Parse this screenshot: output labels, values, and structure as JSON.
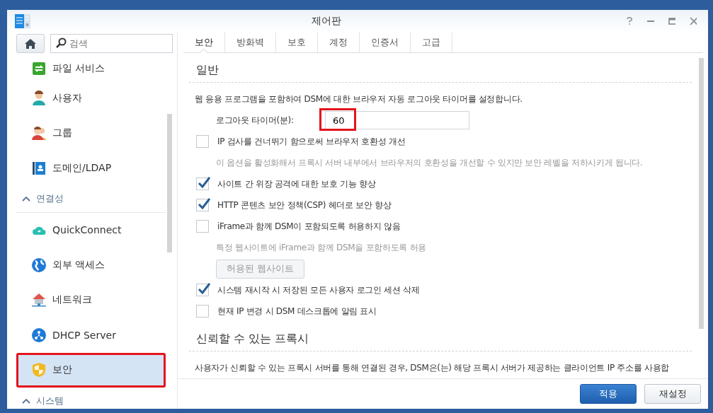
{
  "window": {
    "title": "제어판"
  },
  "search": {
    "placeholder": "검색"
  },
  "sidebar": {
    "items": [
      {
        "kind": "item",
        "label": "파일 서비스",
        "selected": false,
        "highlighted": false
      },
      {
        "kind": "item",
        "label": "사용자",
        "selected": false,
        "highlighted": false
      },
      {
        "kind": "item",
        "label": "그룹",
        "selected": false,
        "highlighted": false
      },
      {
        "kind": "item",
        "label": "도메인/LDAP",
        "selected": false,
        "highlighted": false
      },
      {
        "kind": "section",
        "label": "연결성",
        "expanded": true
      },
      {
        "kind": "item",
        "label": "QuickConnect",
        "selected": false,
        "highlighted": false
      },
      {
        "kind": "item",
        "label": "외부 액세스",
        "selected": false,
        "highlighted": false
      },
      {
        "kind": "item",
        "label": "네트워크",
        "selected": false,
        "highlighted": false
      },
      {
        "kind": "item",
        "label": "DHCP Server",
        "selected": false,
        "highlighted": false
      },
      {
        "kind": "item",
        "label": "보안",
        "selected": true,
        "highlighted": true
      },
      {
        "kind": "section",
        "label": "시스템",
        "expanded": true
      }
    ]
  },
  "tabs": [
    {
      "label": "보안",
      "selected": true
    },
    {
      "label": "방화벽",
      "selected": false
    },
    {
      "label": "보호",
      "selected": false
    },
    {
      "label": "계정",
      "selected": false
    },
    {
      "label": "인증서",
      "selected": false
    },
    {
      "label": "고급",
      "selected": false
    }
  ],
  "sections": [
    {
      "title": "일반",
      "rows": [
        {
          "kind": "text",
          "text": "웹 응용 프로그램을 포함하여 DSM에 대한 브라우저 자동 로그아웃 타이머를 설정합니다."
        },
        {
          "kind": "field",
          "label": "로그아웃 타이머(분):",
          "value": "60",
          "highlighted": true
        },
        {
          "kind": "checkbox",
          "label": "IP 검사를 건너뛰기 함으로써 브라우저 호환성 개선",
          "checked": false
        },
        {
          "kind": "hint",
          "text": "이 옵션을 활성화해서 프록시 서버 내부에서 브라우저의 호환성을 개선할 수 있지만 보안 레벨을 저하시키게 됩니다."
        },
        {
          "kind": "checkbox",
          "label": "사이트 간 위장 공격에 대한 보호 기능 향상",
          "checked": true
        },
        {
          "kind": "checkbox",
          "label": "HTTP 콘텐츠 보안 정책(CSP) 헤더로 보안 향상",
          "checked": true
        },
        {
          "kind": "checkbox",
          "label": "iFrame과 함께 DSM이 포함되도록 허용하지 않음",
          "checked": false
        },
        {
          "kind": "hint",
          "text": "특정 웹사이트에 iFrame과 함께 DSM을 포함하도록 허용"
        },
        {
          "kind": "button",
          "label": "허용된 웹사이트",
          "disabled": true
        },
        {
          "kind": "checkbox",
          "label": "시스템 재시작 시 저장된 모든 사용자 로그인 세션 삭제",
          "checked": true
        },
        {
          "kind": "checkbox",
          "label": "현재 IP 변경 시 DSM 데스크톱에 알림 표시",
          "checked": false
        }
      ]
    },
    {
      "title": "신뢰할 수 있는 프록시",
      "rows": [
        {
          "kind": "text",
          "text": "사용자가 신뢰할 수 있는 프록시 서버를 통해 연결된 경우, DSM은(는) 해당 프록시 서버가 제공하는 클라이언트 IP 주소를 사용합"
        }
      ]
    }
  ],
  "footer": {
    "buttons": [
      {
        "label": "적용",
        "kind": "primary"
      },
      {
        "label": "재설정",
        "kind": "secondary"
      }
    ]
  }
}
